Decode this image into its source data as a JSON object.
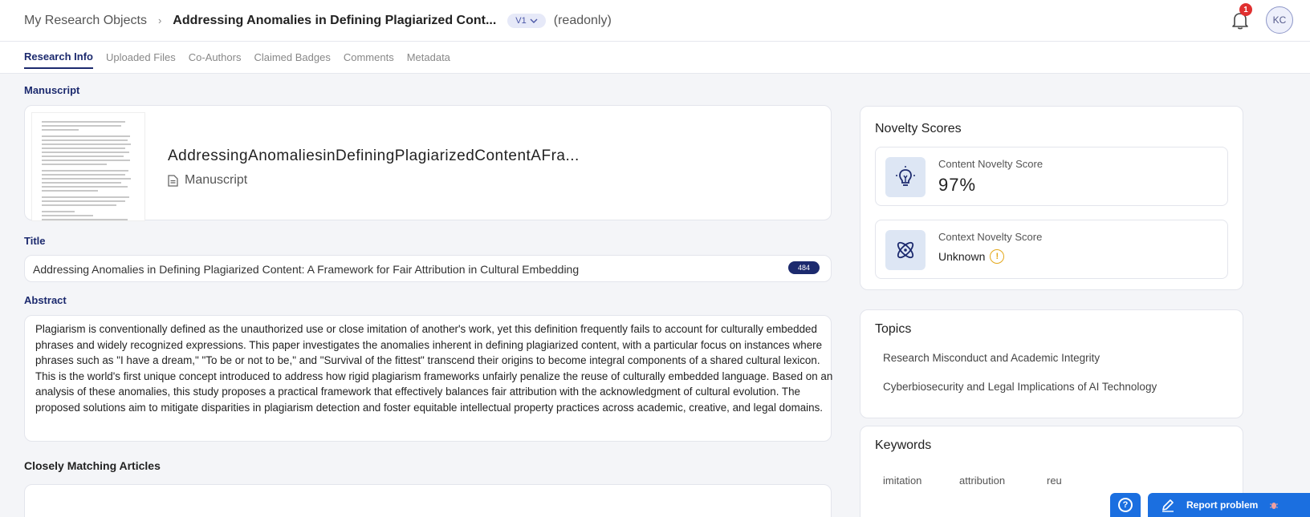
{
  "header": {
    "root_crumb": "My Research Objects",
    "separator": "›",
    "title": "Addressing Anomalies in Defining Plagiarized Cont...",
    "version": "V1",
    "status": "(readonly)",
    "notification_count": "1",
    "avatar_initials": "KC"
  },
  "tabs": [
    {
      "label": "Research Info",
      "active": true
    },
    {
      "label": "Uploaded Files",
      "active": false
    },
    {
      "label": "Co-Authors",
      "active": false
    },
    {
      "label": "Claimed Badges",
      "active": false
    },
    {
      "label": "Comments",
      "active": false
    },
    {
      "label": "Metadata",
      "active": false
    }
  ],
  "manuscript": {
    "section_label": "Manuscript",
    "file_name": "AddressingAnomaliesinDefiningPlagiarizedContentAFra...",
    "file_type": "Manuscript"
  },
  "title_field": {
    "label": "Title",
    "value": "Addressing Anomalies in Defining Plagiarized Content: A Framework for Fair Attribution in Cultural Embedding",
    "count": "484"
  },
  "abstract_field": {
    "label": "Abstract",
    "value": "Plagiarism is conventionally defined as the unauthorized use or close imitation of another's work, yet this definition frequently fails to account for culturally embedded phrases and widely recognized expressions. This paper investigates the anomalies inherent in defining plagiarized content, with a particular focus on instances where phrases such as \"I have a dream,\" \"To be or not to be,\" and \"Survival of the fittest\" transcend their origins to become integral components of a shared cultural lexicon. This is the world's first unique concept introduced to address how rigid plagiarism frameworks unfairly penalize the reuse of culturally embedded language. Based on an analysis of these anomalies, this study proposes a practical framework that effectively balances fair attribution with the acknowledgment of cultural evolution. The proposed solutions aim to mitigate disparities in plagiarism detection and foster equitable intellectual property practices across academic, creative, and legal domains."
  },
  "matching": {
    "label": "Closely Matching Articles"
  },
  "novelty": {
    "title": "Novelty Scores",
    "content_label": "Content Novelty Score",
    "content_value": "97%",
    "context_label": "Context Novelty Score",
    "context_value": "Unknown",
    "warn_glyph": "!"
  },
  "topics": {
    "title": "Topics",
    "items": [
      "Research Misconduct and Academic Integrity",
      "Cyberbiosecurity and Legal Implications of AI Technology"
    ]
  },
  "keywords": {
    "title": "Keywords",
    "items": [
      "imitation",
      "attribution",
      "reu"
    ]
  },
  "floating": {
    "help_glyph": "?",
    "report_label": "Report problem"
  },
  "colors": {
    "accent": "#1c2a6e",
    "action_blue": "#1b6fe0",
    "warning": "#e4a81b",
    "badge_red": "#e03030"
  }
}
